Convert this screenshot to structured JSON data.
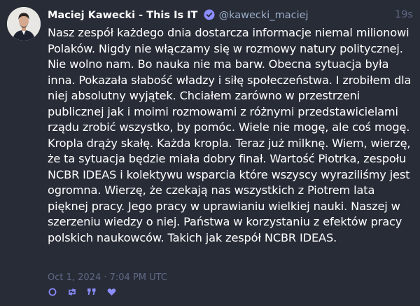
{
  "status": {
    "display_name": "Maciej Kawecki - This Is IT",
    "acct": "@kawecki_maciej",
    "relative_time": "19s",
    "content": "Nasz zespół każdego dnia dostarcza informacje niemal milionowi Polaków. Nigdy nie włączamy się w rozmowy natury politycznej. Nie wolno nam. Bo nauka nie ma barw. Obecna sytuacja była inna. Pokazała słabość władzy i siłę społeczeństwa. I zrobiłem dla niej absolutny wyjątek. Chciałem zarówno w przestrzeni publicznej jak i moimi rozmowami z różnymi przedstawicielami rządu zrobić wszystko, by pomóc. Wiele nie mogę, ale coś mogę. Kropla drąży skałę. Każda kropla. Teraz już milknę. Wiem, wierzę, że ta sytuacja będzie miała dobry finał. Wartość Piotrka, zespołu NCBR IDEAS i kolektywu wsparcia które wszyscy wyraziliśmy jest ogromna. Wierzę, że czekają nas wszystkich z Piotrem lata pięknej pracy. Jego pracy w uprawianiu wielkiej nauki. Naszej w szerzeniu wiedzy o niej. Państwa w korzystaniu z efektów pracy polskich naukowców. Takich jak zespół NCBR IDEAS.",
    "timestamp": "Oct 1, 2024 · 7:04 PM UTC"
  },
  "icons": {
    "verified": "verified-badge-icon",
    "reply": "reply-icon",
    "boost": "boost-icon",
    "quote": "quote-icon",
    "favourite": "heart-icon"
  },
  "colors": {
    "background": "#282c37",
    "text": "#ffffff",
    "muted": "#606984",
    "acct": "#9baec8",
    "accent": "#8c8dff"
  }
}
